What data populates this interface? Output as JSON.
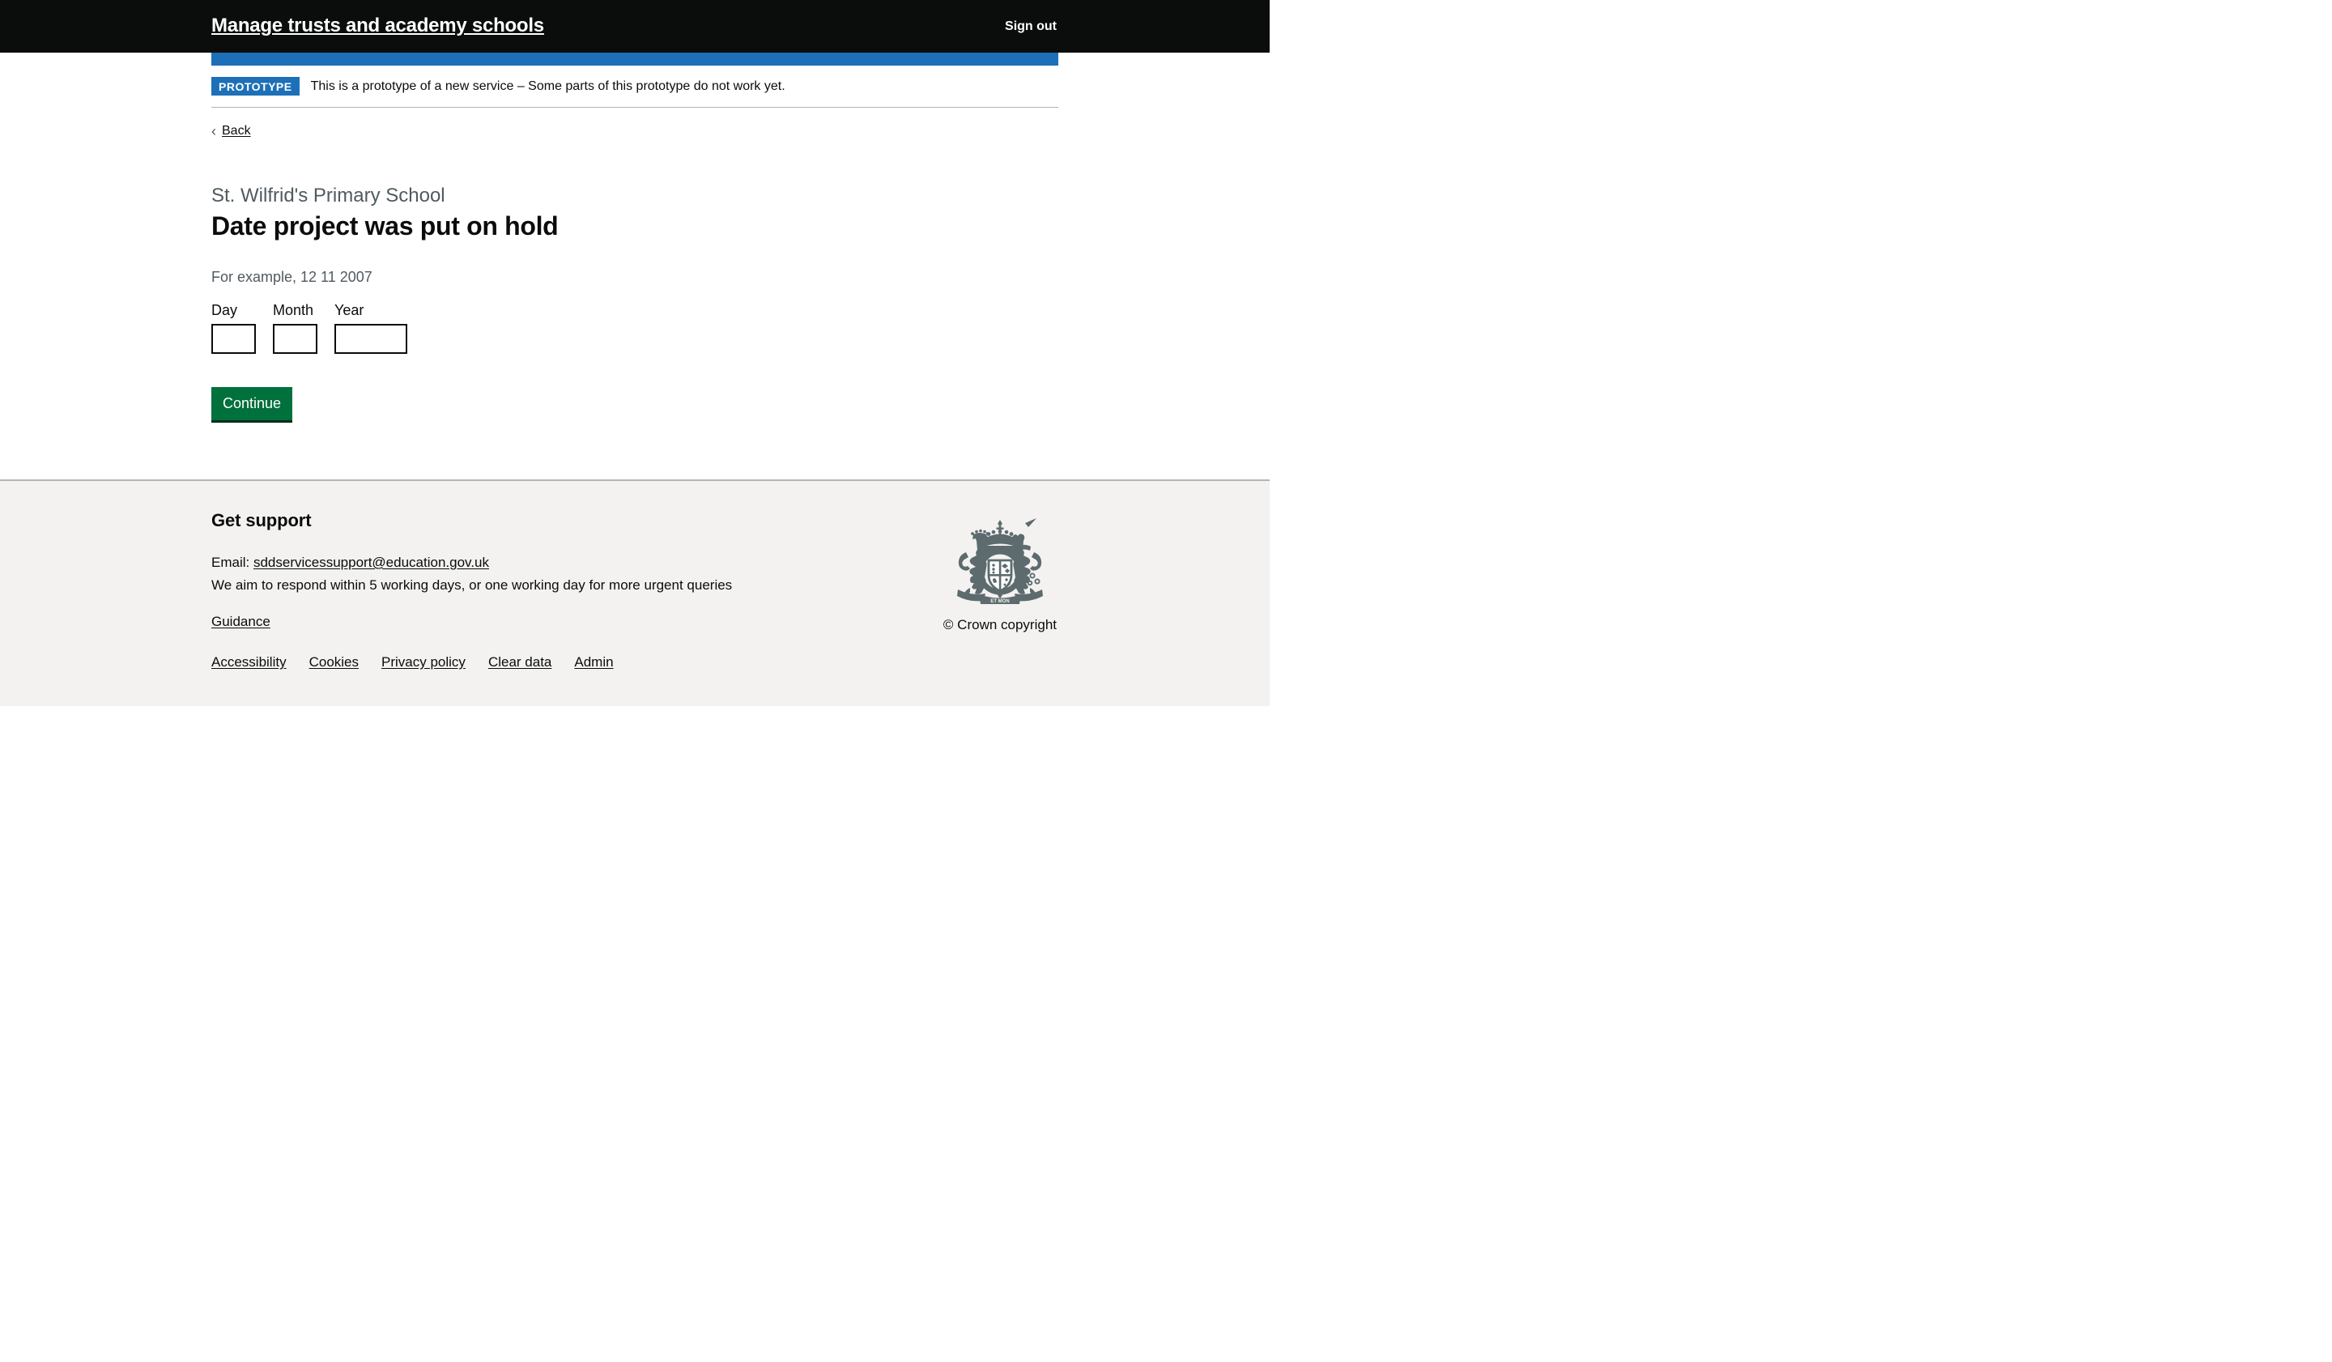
{
  "header": {
    "service_name": "Manage trusts and academy schools",
    "sign_out_label": "Sign out",
    "background_color": "#0b0c0c",
    "accent_bar_color": "#1d70b8"
  },
  "phase_banner": {
    "tag": "PROTOTYPE",
    "text": "This is a prototype of a new service – Some parts of this prototype do not work yet.",
    "tag_color": "#1d70b8"
  },
  "back_link": {
    "label": "Back",
    "chevron": "chevron-left-icon"
  },
  "main": {
    "caption": "St. Wilfrid's Primary School",
    "heading": "Date project was put on hold",
    "hint": "For example, 12 11 2007",
    "date_fields": [
      {
        "label": "Day",
        "value": "",
        "width": "2"
      },
      {
        "label": "Month",
        "value": "",
        "width": "2"
      },
      {
        "label": "Year",
        "value": "",
        "width": "4"
      }
    ],
    "continue_label": "Continue",
    "continue_color": "#00703c"
  },
  "footer": {
    "heading": "Get support",
    "email_prefix": "Email: ",
    "email_address": "sddservicessupport@education.gov.uk",
    "response_time": "We aim to respond within 5 working days, or one working day for more urgent queries",
    "guidance_label": "Guidance",
    "links": [
      "Accessibility",
      "Cookies",
      "Privacy policy",
      "Clear data",
      "Admin"
    ],
    "crown_copyright": "© Crown copyright",
    "background_color": "#f3f2f1",
    "border_color": "#b1b4b6"
  }
}
